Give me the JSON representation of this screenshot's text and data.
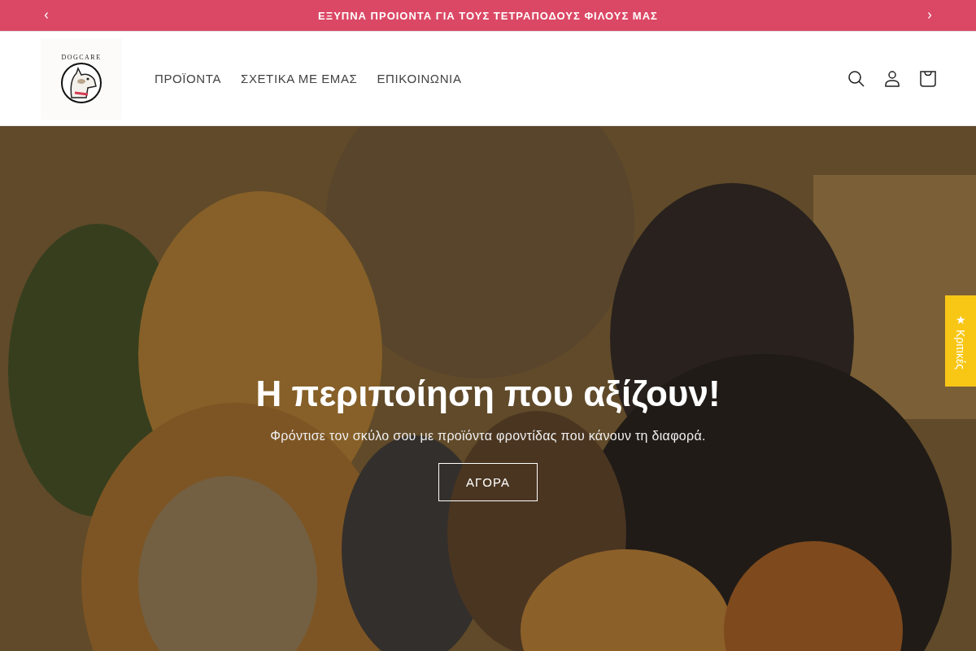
{
  "announcement": {
    "text": "ΕΞΥΠΝΑ ΠΡΟΙΟΝΤΑ ΓΙΑ ΤΟΥΣ ΤΕΤΡΑΠΟΔΟΥΣ ΦΙΛΟΥΣ ΜΑΣ"
  },
  "logo": {
    "text": "DOGCARE"
  },
  "nav": [
    {
      "label": "ΠΡΟΪΟΝΤΑ"
    },
    {
      "label": "ΣΧΕΤΙΚΑ ΜΕ ΕΜΑΣ"
    },
    {
      "label": "ΕΠΙΚΟΙΝΩΝΙΑ"
    }
  ],
  "hero": {
    "title": "Η περιποίηση που αξίζουν!",
    "subtitle": "Φρόντισε τον σκύλο σου με προϊόντα φροντίδας που κάνουν τη διαφορά.",
    "button": "ΑΓΟΡΑ"
  },
  "reviews_tab": {
    "label": "★ Κριτικές"
  }
}
